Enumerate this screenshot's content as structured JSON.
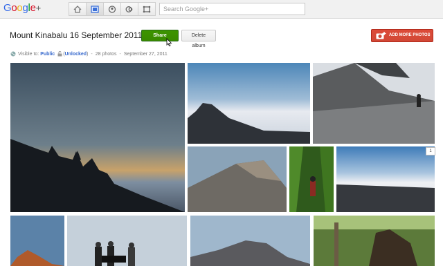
{
  "app": {
    "logo": "Google+",
    "nav": [
      {
        "icon": "home-icon",
        "active": false
      },
      {
        "icon": "photos-icon",
        "active": true
      },
      {
        "icon": "profile-icon",
        "active": false
      },
      {
        "icon": "circles-icon",
        "active": false
      },
      {
        "icon": "games-icon",
        "active": false
      }
    ],
    "search_placeholder": "Search Google+"
  },
  "album": {
    "title": "Mount Kinabalu 16 September 2011",
    "share_label": "Share album",
    "delete_label": "Delete album",
    "add_photos_label": "ADD MORE PHOTOS",
    "visible_prefix": "Visible to:",
    "visibility": "Public",
    "unlocked": "Unlocked",
    "photo_count": "28 photos",
    "date": "September 27, 2011"
  },
  "photos": [
    {
      "id": "sunrise-peaks"
    },
    {
      "id": "south-peak-clouds"
    },
    {
      "id": "summit-trail-hiker"
    },
    {
      "id": "granite-slope"
    },
    {
      "id": "jungle-trail"
    },
    {
      "id": "summit-plateau"
    },
    {
      "id": "night-summit"
    },
    {
      "id": "summit-group"
    },
    {
      "id": "peak-silhouette"
    },
    {
      "id": "rainforest-stump"
    }
  ],
  "badge_count": "1",
  "colors": {
    "share_green": "#3d9400",
    "add_red": "#dd4b39",
    "link_blue": "#3366cc"
  }
}
